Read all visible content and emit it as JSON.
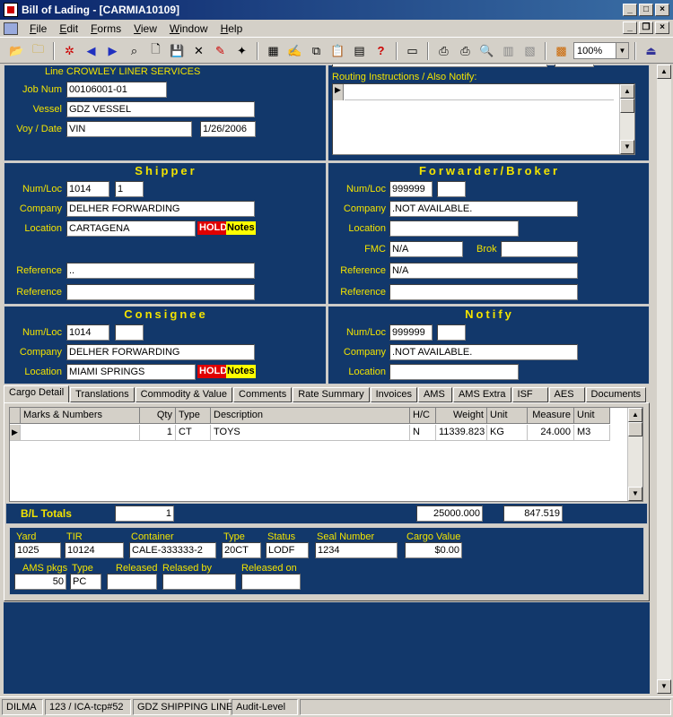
{
  "window": {
    "title": "Bill of Lading - [CARMIA10109]"
  },
  "menu": [
    {
      "label": "File",
      "u": "F",
      "rest": "ile"
    },
    {
      "label": "Edit",
      "u": "E",
      "rest": "dit"
    },
    {
      "label": "Forms",
      "u": "F",
      "rest": "orms"
    },
    {
      "label": "View",
      "u": "V",
      "rest": "iew"
    },
    {
      "label": "Window",
      "u": "W",
      "rest": "indow"
    },
    {
      "label": "Help",
      "u": "H",
      "rest": "elp"
    }
  ],
  "toolbar": {
    "zoom": "100%"
  },
  "header": {
    "line_label": "Line",
    "line_value": "CROWLEY LINER SERVICES",
    "job_label": "Job Num",
    "job_value": "00106001-01",
    "vessel_label": "Vessel",
    "vessel_value": "GDZ VESSEL",
    "voy_label": "Voy / Date",
    "voy_value": "VIN",
    "date_value": "1/26/2006",
    "routing_label": "Routing Instructions / Also Notify:"
  },
  "shipper": {
    "title": "Shipper",
    "numloc_label": "Num/Loc",
    "num": "1014",
    "loc": "1",
    "company_label": "Company",
    "company": "DELHER FORWARDING",
    "location_label": "Location",
    "location": "CARTAGENA",
    "hold": "HOLD",
    "notes": "Notes",
    "reference_label": "Reference",
    "reference1": "..",
    "reference2": ""
  },
  "forwarder": {
    "title": "Forwarder/Broker",
    "numloc_label": "Num/Loc",
    "num": "999999",
    "loc": "",
    "company_label": "Company",
    "company": ".NOT AVAILABLE.",
    "location_label": "Location",
    "location": "",
    "fmc_label": "FMC",
    "fmc": "N/A",
    "brok_label": "Brok",
    "brok": "",
    "reference_label": "Reference",
    "reference1": "N/A",
    "reference2": ""
  },
  "consignee": {
    "title": "Consignee",
    "numloc_label": "Num/Loc",
    "num": "1014",
    "loc": "",
    "company_label": "Company",
    "company": "DELHER FORWARDING",
    "location_label": "Location",
    "location": "MIAMI SPRINGS",
    "hold": "HOLD",
    "notes": "Notes"
  },
  "notify": {
    "title": "Notify",
    "numloc_label": "Num/Loc",
    "num": "999999",
    "loc": "",
    "company_label": "Company",
    "company": ".NOT AVAILABLE.",
    "location_label": "Location",
    "location": ""
  },
  "tabs": [
    "Cargo Detail",
    "Translations",
    "Commodity & Value",
    "Comments",
    "Rate Summary",
    "Invoices",
    "AMS",
    "AMS Extra",
    "ISF",
    "AES",
    "Documents"
  ],
  "cargo_grid": {
    "headers": [
      "Marks & Numbers",
      "Qty",
      "Type",
      "Description",
      "H/C",
      "Weight",
      "Unit",
      "Measure",
      "Unit"
    ],
    "rows": [
      [
        "",
        "1",
        "CT",
        "TOYS",
        "N",
        "11339.823",
        "KG",
        "24.000",
        "M3"
      ]
    ]
  },
  "totals": {
    "label": "B/L Totals",
    "qty": "1",
    "weight": "25000.000",
    "measure": "847.519"
  },
  "container": {
    "yard_label": "Yard",
    "yard": "1025",
    "tir_label": "TIR",
    "tir": "10124",
    "container_label": "Container",
    "container": "CALE-333333-2",
    "type_label": "Type",
    "type": "20CT",
    "status_label": "Status",
    "status": "LODF",
    "seal_label": "Seal Number",
    "seal": "1234",
    "value_label": "Cargo Value",
    "value": "$0.00",
    "ams_label": "AMS pkgs",
    "ams": "50",
    "ptype_label": "Type",
    "ptype": "PC",
    "released_label": "Released",
    "released": "",
    "relby_label": "Relased by",
    "relby": "",
    "relon_label": "Released on",
    "relon": ""
  },
  "status_bar": [
    "DILMA",
    "123 / ICA-tcp#52",
    "GDZ SHIPPING LINE",
    "Audit-Level"
  ]
}
